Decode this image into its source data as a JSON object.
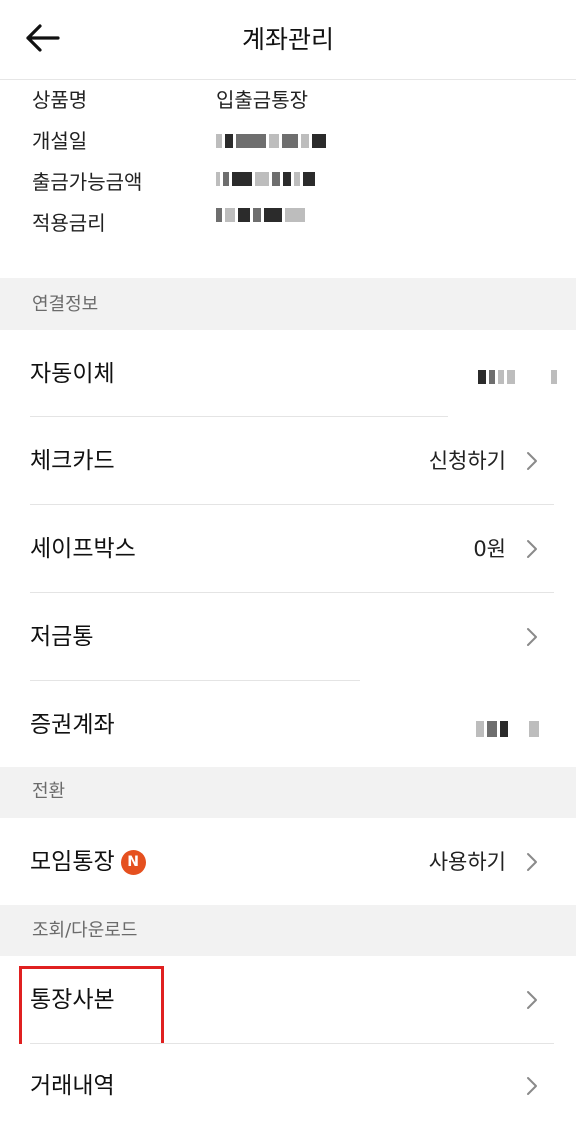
{
  "header": {
    "title": "계좌관리",
    "back_icon": "arrow-left-icon"
  },
  "info": {
    "rows": [
      {
        "label": "상품명",
        "value": "입출금통장"
      },
      {
        "label": "개설일",
        "value": ""
      },
      {
        "label": "출금가능금액",
        "value": ""
      },
      {
        "label": "적용금리",
        "value": ""
      }
    ]
  },
  "sections": {
    "connected": "연결정보",
    "switch": "전환",
    "download": "조회/다운로드"
  },
  "items": {
    "auto_transfer": {
      "label": "자동이체",
      "value": ""
    },
    "check_card": {
      "label": "체크카드",
      "value": "신청하기"
    },
    "safe_box": {
      "label": "세이프박스",
      "value": "0원"
    },
    "piggy_bank": {
      "label": "저금통",
      "value": ""
    },
    "securities": {
      "label": "증권계좌",
      "value": ""
    },
    "group_account": {
      "label": "모임통장",
      "badge": "N",
      "value": "사용하기"
    },
    "passbook_copy": {
      "label": "통장사본",
      "value": ""
    },
    "transactions": {
      "label": "거래내역",
      "value": ""
    }
  },
  "colors": {
    "badge": "#e5501f",
    "highlight": "#e02020",
    "section_bg": "#f2f2f2"
  }
}
